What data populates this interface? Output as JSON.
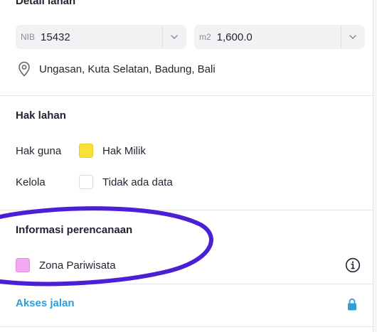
{
  "detail": {
    "title": "Detail lahan",
    "nib": {
      "prefix": "NIB",
      "value": "15432"
    },
    "area": {
      "prefix": "m2",
      "value": "1,600.0"
    },
    "location": "Ungasan, Kuta Selatan, Badung, Bali"
  },
  "hak_lahan": {
    "title": "Hak lahan",
    "rows": [
      {
        "label": "Hak guna",
        "value": "Hak Milik",
        "color": "#f9e13a"
      },
      {
        "label": "Kelola",
        "value": "Tidak ada data",
        "color": "#ffffff"
      }
    ]
  },
  "perencanaan": {
    "title": "Informasi perencanaan",
    "zone": {
      "label": "Zona Pariwisata",
      "color": "#f6a8ef"
    }
  },
  "akses": {
    "label": "Akses jalan",
    "color": "#2f9ed8"
  },
  "annotation": {
    "stroke_color": "#4a1fd6"
  },
  "icons": {
    "location": "map-pin-icon",
    "info": "info-circle-icon",
    "lock": "lock-icon",
    "chevron": "chevron-down-icon"
  }
}
